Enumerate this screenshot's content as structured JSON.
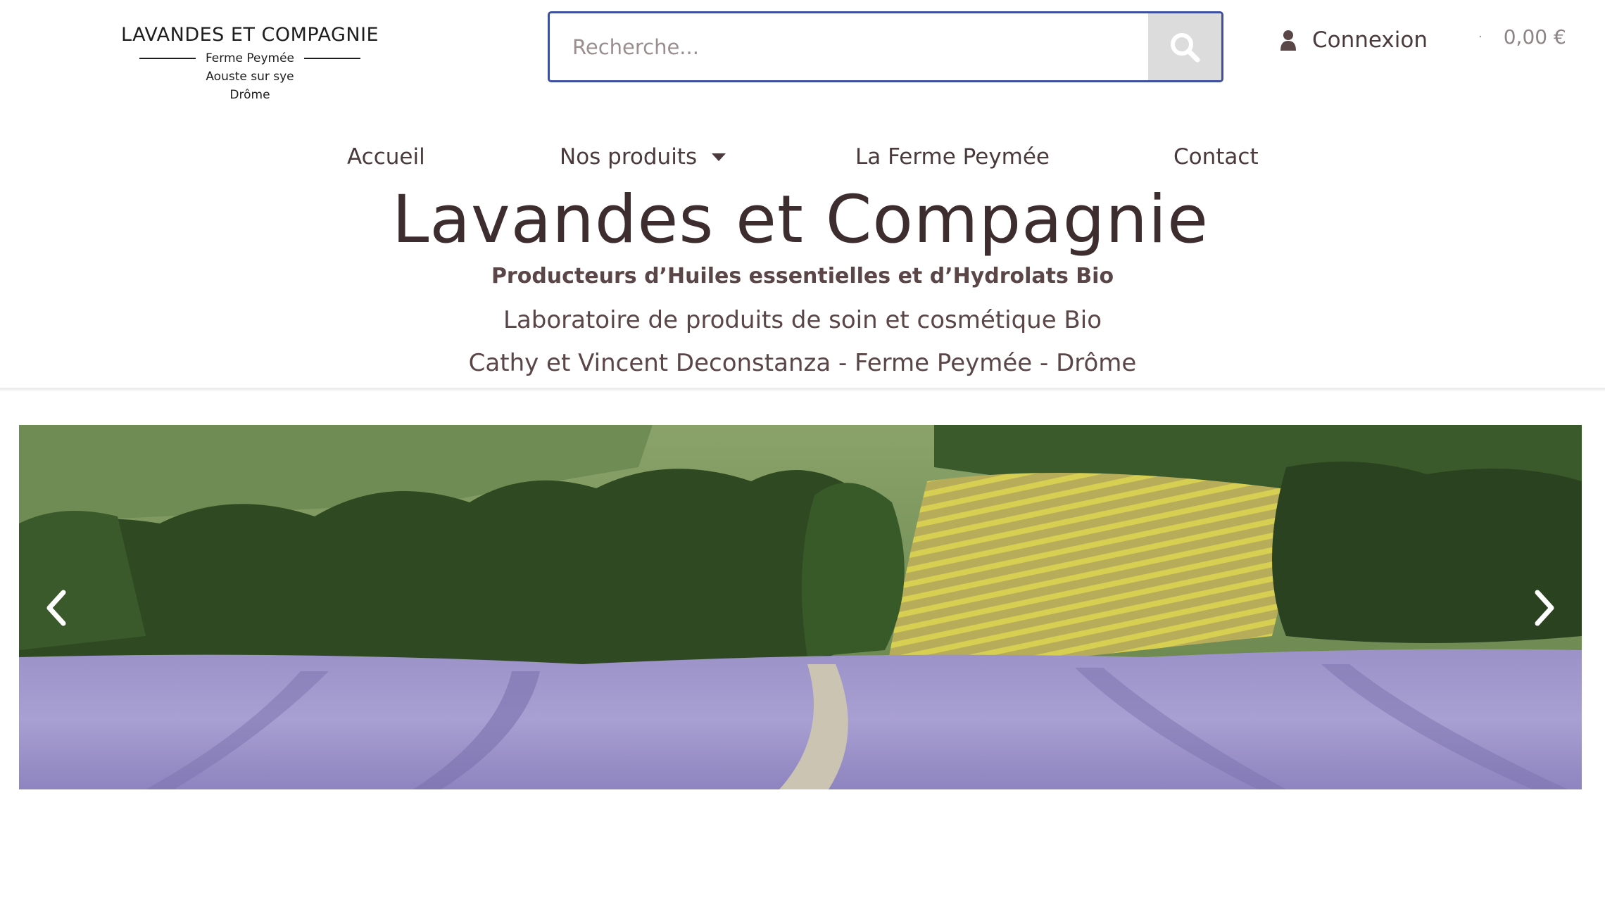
{
  "header": {
    "logo": {
      "title": "LAVANDES ET COMPAGNIE",
      "line1": "Ferme Peymée",
      "line2": "Aouste sur sye",
      "line3": "Drôme"
    },
    "search": {
      "placeholder": "Recherche...",
      "value": "",
      "icon": "search-icon"
    },
    "account": {
      "icon": "user-icon",
      "label": "Connexion"
    },
    "cart": {
      "separator": "·",
      "total": "0,00 €"
    }
  },
  "nav": {
    "items": [
      {
        "label": "Accueil"
      },
      {
        "label": "Nos produits",
        "icon": "caret-down-icon"
      },
      {
        "label": "La Ferme Peymée"
      },
      {
        "label": "Contact"
      }
    ]
  },
  "hero_text": {
    "title": "Lavandes et Compagnie",
    "subtitle": "Producteurs d’Huiles essentielles et d’Hydrolats Bio",
    "tagline": "Laboratoire de produits de soin et cosmétique  Bio",
    "owners": "Cathy et Vincent Deconstanza - Ferme Peymée - Drôme"
  },
  "carousel": {
    "prev_icon": "chevron-left-icon",
    "next_icon": "chevron-right-icon",
    "image": "lavender-field-landscape",
    "colors": {
      "sky_hill": "#7f9b62",
      "forest": "#2f4a22",
      "lavender": "#a59ad0",
      "yellow_field": "#c9c84a"
    }
  },
  "colors": {
    "text": "#4a3a3c",
    "title": "#3e2d2f",
    "search_border": "#3f4fa0",
    "search_button": "#dcdcdc"
  }
}
